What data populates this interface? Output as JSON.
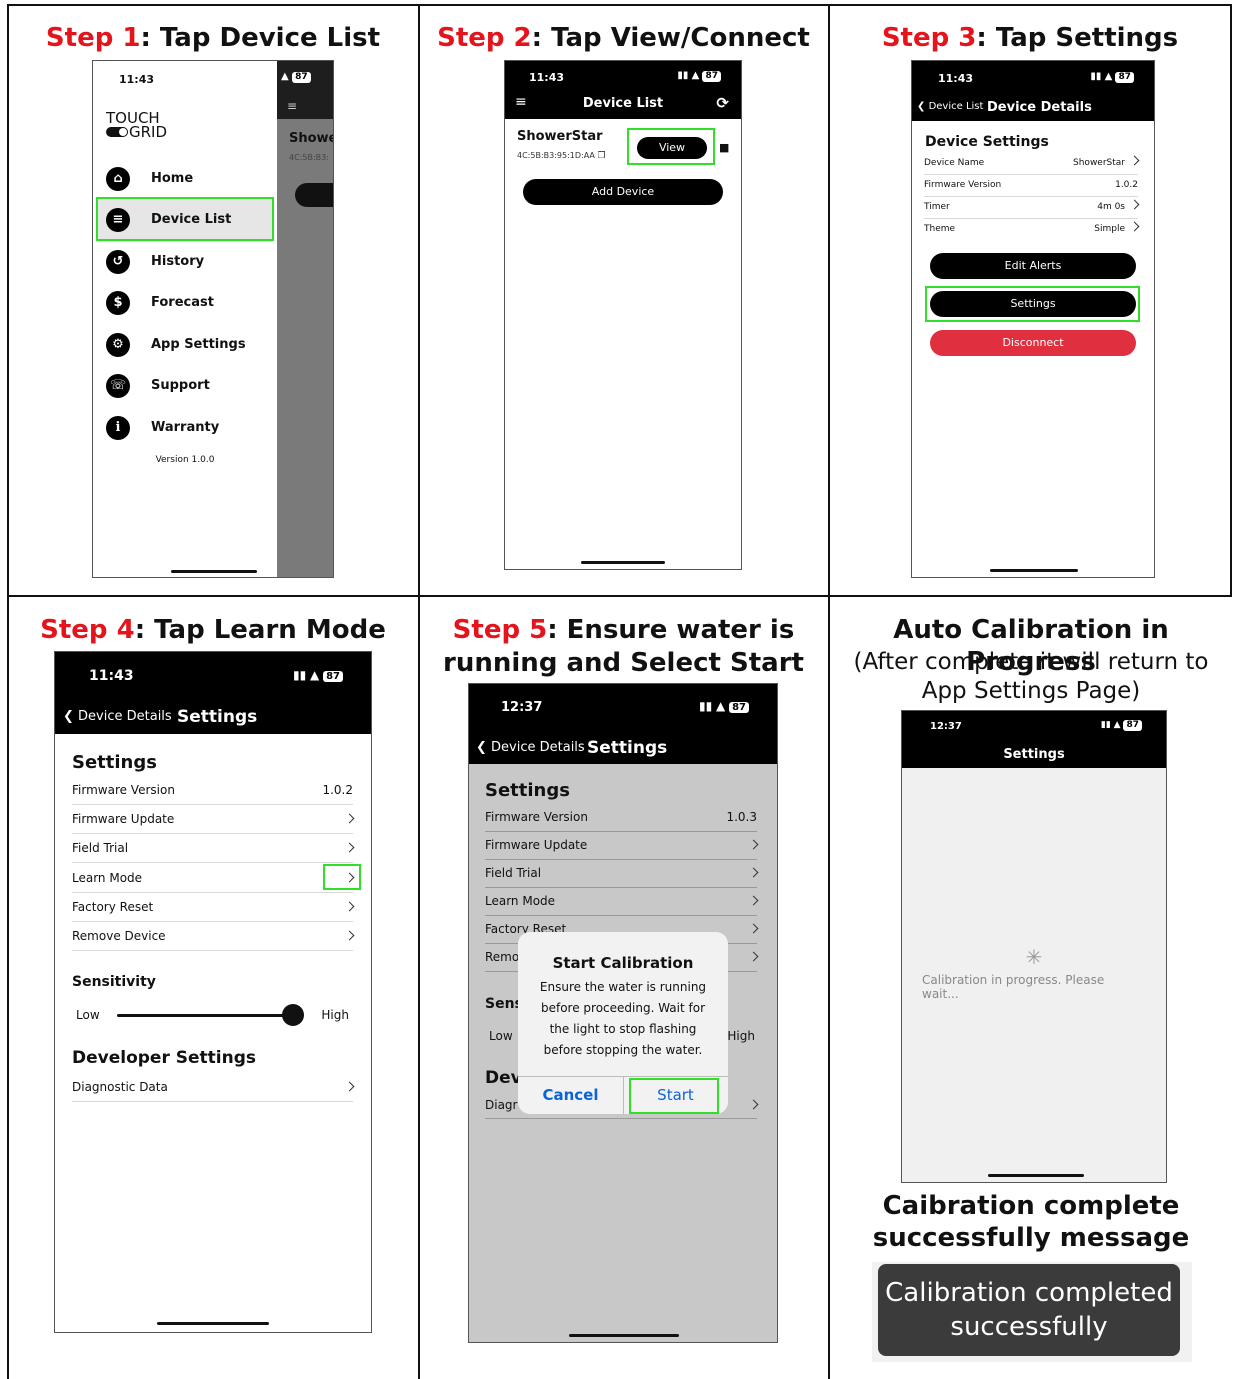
{
  "steps": {
    "s1": {
      "red": "Step 1",
      "rest": ": Tap Device List"
    },
    "s2": {
      "red": "Step 2",
      "rest": ": Tap View/Connect"
    },
    "s3": {
      "red": "Step 3",
      "rest": ": Tap Settings"
    },
    "s4": {
      "red": "Step 4",
      "rest": ": Tap Learn Mode"
    },
    "s5": {
      "red": "Step 5",
      "rest": ": Ensure water is",
      "line2": "running and Select Start"
    },
    "s6": {
      "title": "Auto Calibration in Progress",
      "sub1": "(After complete it will return to",
      "sub2": "App Settings Page)"
    }
  },
  "status": {
    "time1": "11:43",
    "time2": "12:37",
    "battery": "87"
  },
  "phone1": {
    "logo_top": "TOUCH",
    "logo_bottom": "GRID",
    "menu": [
      "Home",
      "Device List",
      "History",
      "Forecast",
      "App Settings",
      "Support",
      "Warranty"
    ],
    "version": "Version 1.0.0",
    "peek_name": "Showe",
    "peek_mac": "4C:5B:B3:"
  },
  "phone2": {
    "title": "Device List",
    "device_name": "ShowerStar",
    "device_mac": "4C:5B:B3:95:1D:AA",
    "view_label": "View",
    "add_label": "Add Device"
  },
  "phone3": {
    "back": "Device List",
    "title": "Device Details",
    "section": "Device Settings",
    "rows": [
      {
        "label": "Device Name",
        "value": "ShowerStar"
      },
      {
        "label": "Firmware Version",
        "value": "1.0.2"
      },
      {
        "label": "Timer",
        "value": "4m 0s"
      },
      {
        "label": "Theme",
        "value": "Simple"
      }
    ],
    "edit_alerts": "Edit Alerts",
    "settings": "Settings",
    "disconnect": "Disconnect"
  },
  "phone4": {
    "back": "Device Details",
    "title": "Settings",
    "section": "Settings",
    "rows": [
      {
        "label": "Firmware Version",
        "value": "1.0.2"
      },
      {
        "label": "Firmware Update",
        "value": ""
      },
      {
        "label": "Field Trial",
        "value": ""
      },
      {
        "label": "Learn Mode",
        "value": ""
      },
      {
        "label": "Factory Reset",
        "value": ""
      },
      {
        "label": "Remove Device",
        "value": ""
      }
    ],
    "sensitivity": "Sensitivity",
    "low": "Low",
    "high": "High",
    "sensitivity_level": 1.0,
    "dev_section": "Developer Settings",
    "diag": "Diagnostic Data"
  },
  "phone5": {
    "back": "Device Details",
    "title": "Settings",
    "section": "Settings",
    "rows": [
      {
        "label": "Firmware Version",
        "value": "1.0.3"
      },
      {
        "label": "Firmware Update",
        "value": ""
      },
      {
        "label": "Field Trial",
        "value": ""
      },
      {
        "label": "Learn Mode",
        "value": ""
      },
      {
        "label": "Factory Reset",
        "value": ""
      },
      {
        "label": "Remove Device",
        "value": ""
      }
    ],
    "sens_partial": "Sens",
    "low": "Low",
    "high_partial": "High",
    "dev_partial": "Dev",
    "diag_partial": "Diagr",
    "dialog_title": "Start Calibration",
    "dialog_lines": [
      "Ensure the water is running",
      "before proceeding. Wait for",
      "the light to stop flashing",
      "before stopping the water."
    ],
    "cancel": "Cancel",
    "start": "Start"
  },
  "phone6": {
    "title": "Settings",
    "progress_line1": "Calibration in progress. Please",
    "progress_line2": "wait..."
  },
  "complete": {
    "heading1": "Caibration complete",
    "heading2": "successfully message",
    "toast1": "Calibration completed",
    "toast2": "successfully"
  },
  "colors": {
    "red": "#e3141b",
    "green": "#2ee02a",
    "disconnect": "#e0303f",
    "ios_blue": "#0a64d8"
  }
}
